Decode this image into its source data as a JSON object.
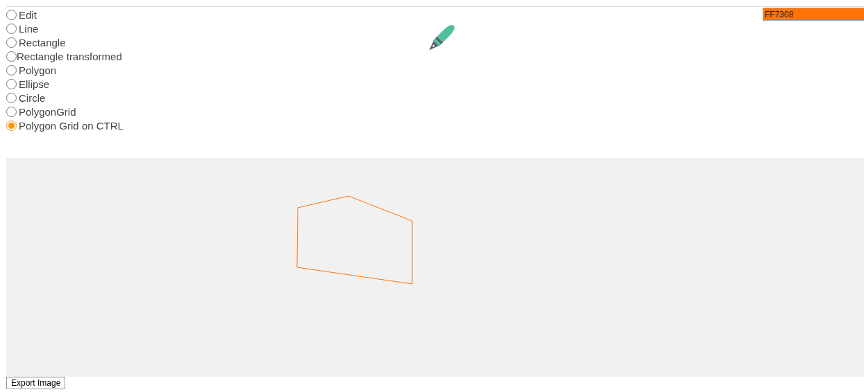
{
  "tools": [
    {
      "label": "Edit",
      "selected": false
    },
    {
      "label": "Line",
      "selected": false
    },
    {
      "label": "Rectangle",
      "selected": false
    },
    {
      "label": "Rectangle transformed",
      "selected": false
    },
    {
      "label": "Polygon",
      "selected": false
    },
    {
      "label": "Ellipse",
      "selected": false
    },
    {
      "label": "Circle",
      "selected": false
    },
    {
      "label": "PolygonGrid",
      "selected": false
    },
    {
      "label": "Polygon Grid on CTRL",
      "selected": true
    }
  ],
  "color_field": {
    "value": "FF7308"
  },
  "export_button": "Export Image"
}
